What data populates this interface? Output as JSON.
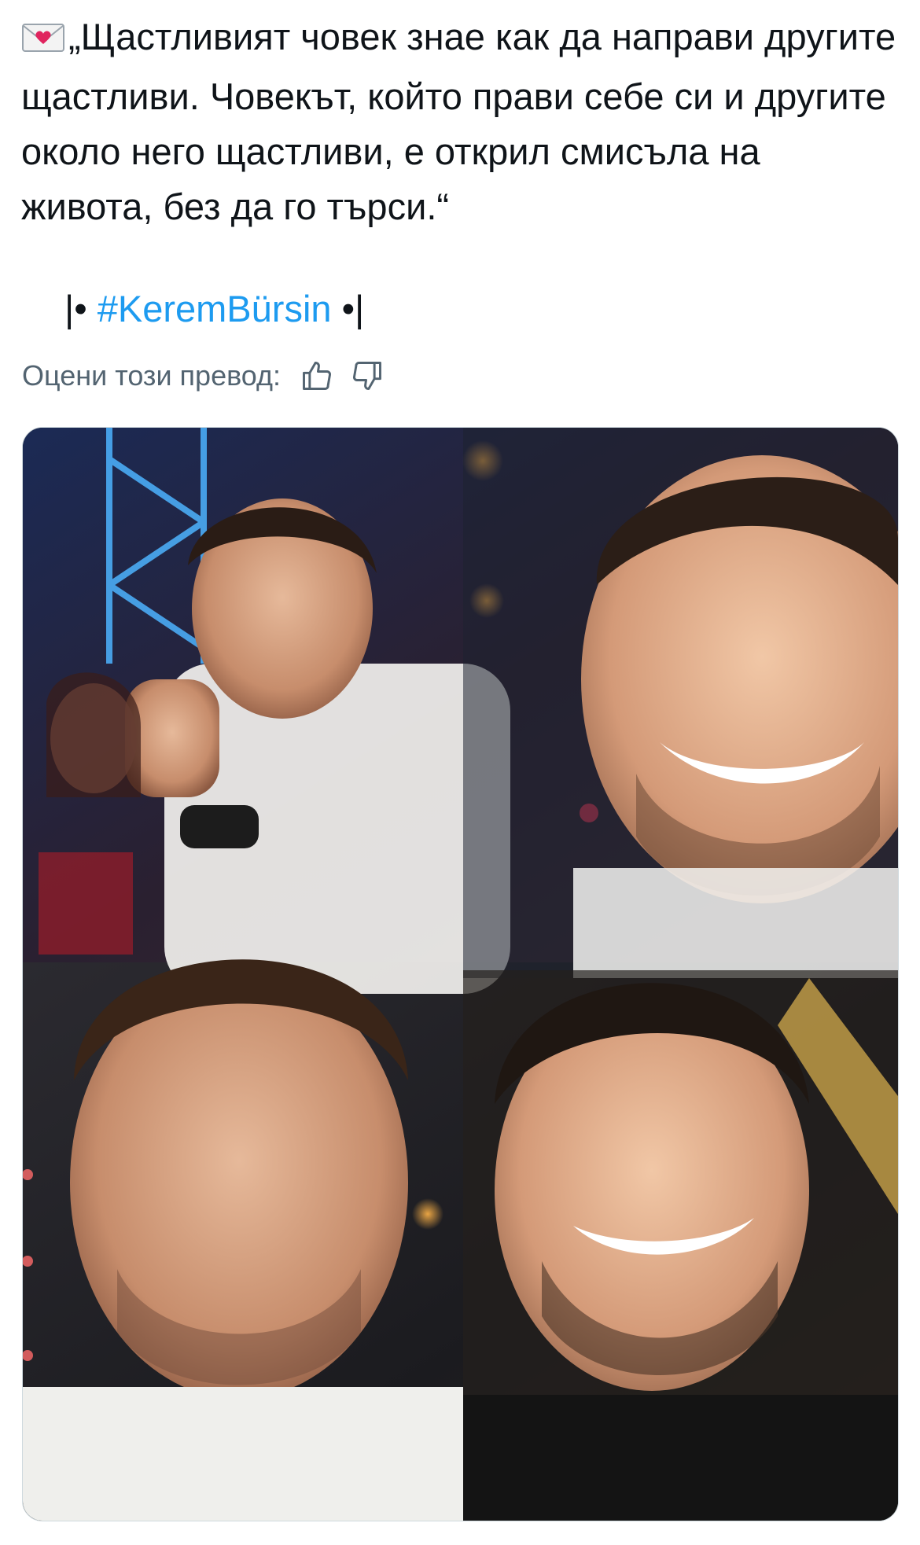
{
  "tweet": {
    "envelope_icon": "love-letter-icon",
    "text": "„Щастливият човек знае как да направи другите щастливи. Човекът, който прави себе си и другите около него щастливи, е открил смисъла на живота, без да го търси.“",
    "hashtag_prefix": "|• ",
    "hashtag": "#KeremBürsin",
    "hashtag_suffix": " •|"
  },
  "translation_rating": {
    "label": "Оцени този превод:",
    "thumbs_up_icon": "thumbs-up-icon",
    "thumbs_down_icon": "thumbs-down-icon"
  },
  "media": {
    "alt": "Collage of four photos of Kerem Bürsin smiling",
    "accent_colors": {
      "hashtag": "#1d9bf0",
      "secondary_text": "#536471"
    }
  }
}
